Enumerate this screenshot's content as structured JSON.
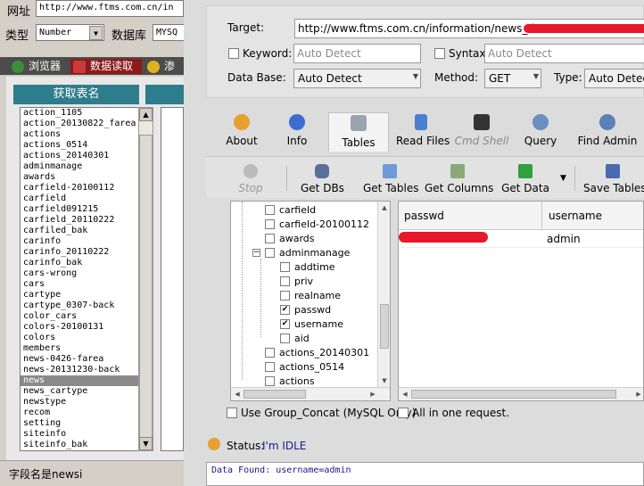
{
  "left_tool": {
    "url_label": "网址",
    "url_value": "http://www.ftms.com.cn/in",
    "type_label": "类型",
    "type_value": "Number",
    "db_label": "数据库",
    "db_value": "MYSQ",
    "tabs": [
      "浏览器",
      "数据读取",
      "渗"
    ],
    "table_header": "获取表名",
    "tables": [
      "action_1105",
      "action_20130822_farea",
      "actions",
      "actions_0514",
      "actions_20140301",
      "adminmanage",
      "awards",
      "carfield-20100112",
      "carfield",
      "carfield091215",
      "carfield_20110222",
      "carfiled_bak",
      "carinfo",
      "carinfo_20110222",
      "carinfo_bak",
      "cars-wrong",
      "cars",
      "cartype",
      "cartype_0307-back",
      "color_cars",
      "colors-20100131",
      "colors",
      "members",
      "news-0426-farea",
      "news-20131230-back",
      "news",
      "news_cartype",
      "newstype",
      "recom",
      "setting",
      "siteinfo",
      "siteinfo_bak"
    ],
    "selected_table": "news",
    "status_text": "字段名是newsi"
  },
  "havij": {
    "target_label": "Target:",
    "target_value": "http://www.ftms.com.cn/information/news_deta",
    "keyword_label": "Keyword:",
    "keyword_placeholder": "Auto Detect",
    "syntax_label": "Syntax:",
    "syntax_placeholder": "Auto Detect",
    "database_label": "Data Base:",
    "database_value": "Auto Detect",
    "method_label": "Method:",
    "method_value": "GET",
    "type_label": "Type:",
    "type_value": "Auto Detec",
    "menu": [
      "About",
      "Info",
      "Tables",
      "Read Files",
      "Cmd Shell",
      "Query",
      "Find Admin"
    ],
    "toolbar": [
      "Stop",
      "Get DBs",
      "Get Tables",
      "Get Columns",
      "Get Data",
      "Save Tables"
    ],
    "tree": {
      "top_items": [
        "carfield",
        "carfield-20100112",
        "awards"
      ],
      "expanded_table": "adminmanage",
      "columns": [
        "addtime",
        "priv",
        "realname",
        "passwd",
        "username",
        "aid"
      ],
      "checked": [
        "passwd",
        "username"
      ],
      "bottom_items": [
        "actions_20140301",
        "actions_0514",
        "actions"
      ]
    },
    "grid": {
      "headers": [
        "passwd",
        "username"
      ],
      "rows": [
        {
          "passwd": "",
          "username": "admin"
        }
      ]
    },
    "group_concat_label": "Use Group_Concat (MySQL Only)",
    "all_in_one_label": "All in one request.",
    "status_label": "Status:",
    "status_value": "I'm IDLE",
    "log_line": "Data Found: username=admin"
  },
  "colors": {
    "redact": "#e8172a",
    "left_header": "#2e7d8c",
    "status_blue": "#1a1a8a"
  }
}
